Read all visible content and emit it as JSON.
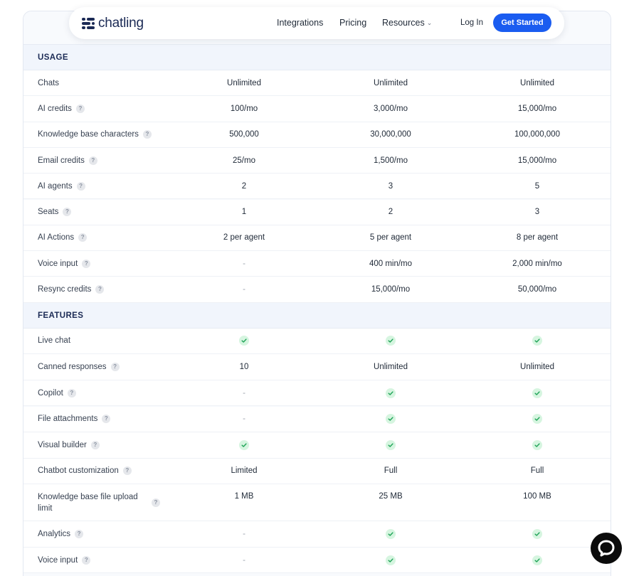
{
  "brand": {
    "name": "chatling",
    "color": "#1b2a55"
  },
  "nav": {
    "links": [
      "Integrations",
      "Pricing",
      "Resources"
    ],
    "login": "Log In",
    "cta": "Get Started",
    "accent": "#1a5cf0"
  },
  "sections": {
    "usage": "USAGE",
    "features": "FEATURES"
  },
  "usage_rows": [
    {
      "label": "Chats",
      "help": false,
      "values": [
        "Unlimited",
        "Unlimited",
        "Unlimited"
      ]
    },
    {
      "label": "AI credits",
      "help": true,
      "values": [
        "100/mo",
        "3,000/mo",
        "15,000/mo"
      ]
    },
    {
      "label": "Knowledge base characters",
      "help": true,
      "values": [
        "500,000",
        "30,000,000",
        "100,000,000"
      ]
    },
    {
      "label": "Email credits",
      "help": true,
      "values": [
        "25/mo",
        "1,500/mo",
        "15,000/mo"
      ]
    },
    {
      "label": "AI agents",
      "help": true,
      "values": [
        "2",
        "3",
        "5"
      ]
    },
    {
      "label": "Seats",
      "help": true,
      "values": [
        "1",
        "2",
        "3"
      ]
    },
    {
      "label": "AI Actions",
      "help": true,
      "values": [
        "2 per agent",
        "5 per agent",
        "8 per agent"
      ]
    },
    {
      "label": "Voice input",
      "help": true,
      "values": [
        "-",
        "400 min/mo",
        "2,000 min/mo"
      ]
    },
    {
      "label": "Resync credits",
      "help": true,
      "values": [
        "-",
        "15,000/mo",
        "50,000/mo"
      ]
    }
  ],
  "feature_rows": [
    {
      "label": "Live chat",
      "help": false,
      "values": [
        "check",
        "check",
        "check"
      ]
    },
    {
      "label": "Canned responses",
      "help": true,
      "values": [
        "10",
        "Unlimited",
        "Unlimited"
      ]
    },
    {
      "label": "Copilot",
      "help": true,
      "values": [
        "-",
        "check",
        "check"
      ]
    },
    {
      "label": "File attachments",
      "help": true,
      "values": [
        "-",
        "check",
        "check"
      ]
    },
    {
      "label": "Visual builder",
      "help": true,
      "values": [
        "check",
        "check",
        "check"
      ]
    },
    {
      "label": "Chatbot customization",
      "help": true,
      "values": [
        "Limited",
        "Full",
        "Full"
      ]
    },
    {
      "label": "Knowledge base file upload limit",
      "help": true,
      "values": [
        "1 MB",
        "25 MB",
        "100 MB"
      ]
    },
    {
      "label": "Analytics",
      "help": true,
      "values": [
        "-",
        "check",
        "check"
      ]
    },
    {
      "label": "Voice input",
      "help": true,
      "values": [
        "-",
        "check",
        "check"
      ]
    }
  ],
  "help_glyph": "?",
  "icons": {
    "check": "check-icon",
    "help": "help-icon",
    "chat": "chat-bubble-icon",
    "chevron": "chevron-down-icon"
  },
  "colors": {
    "check_bg": "#d6f5e0",
    "check_fg": "#22a559",
    "section_bg": "#f1f5fc"
  }
}
